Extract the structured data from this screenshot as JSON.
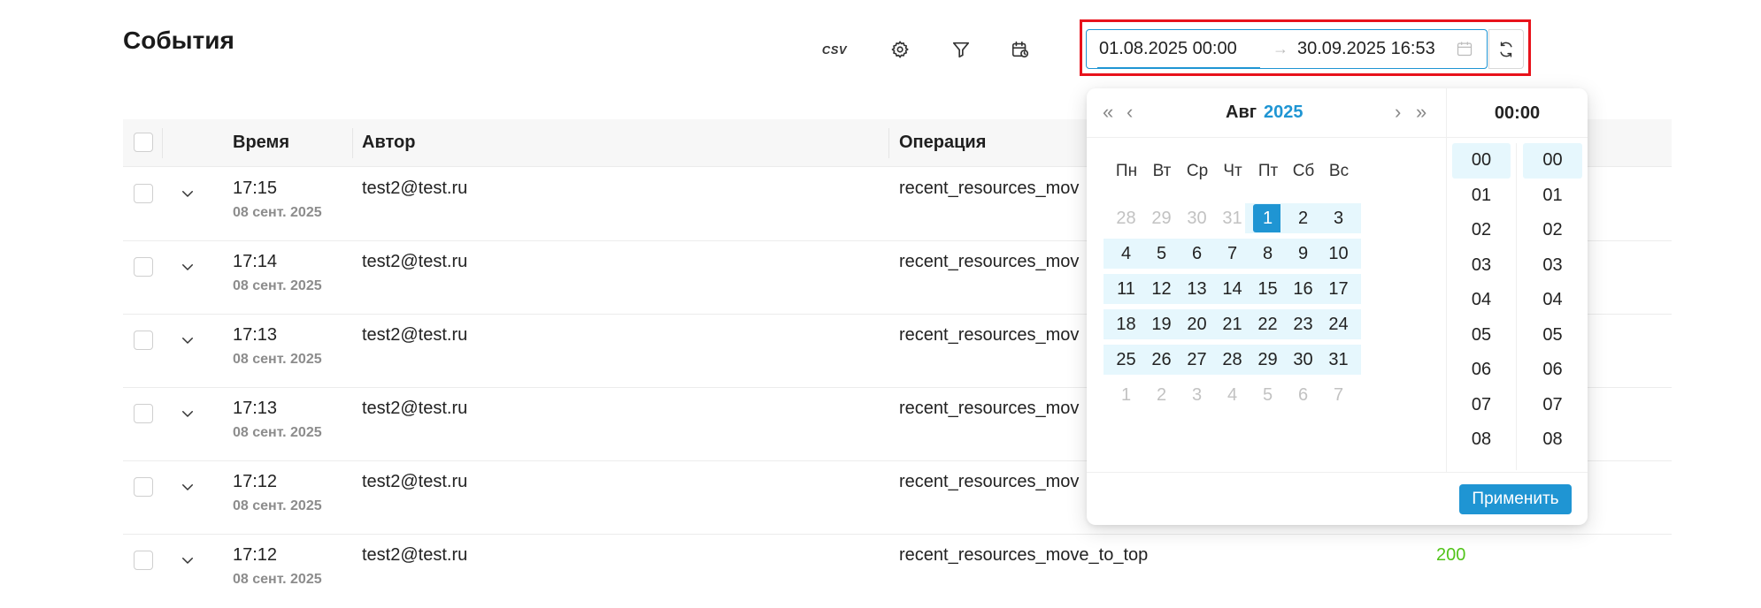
{
  "header": {
    "title": "События",
    "csv_label": "CSV",
    "icons": [
      "settings-icon",
      "filter-icon",
      "calendar-clock-icon"
    ]
  },
  "range": {
    "start": "01.08.2025 00:00",
    "separator": "→",
    "end": "30.09.2025 16:53"
  },
  "table": {
    "headers": {
      "time": "Время",
      "author": "Автор",
      "operation": "Операция"
    },
    "rows": [
      {
        "time": "17:15",
        "date": "08 сент. 2025",
        "author": "test2@test.ru",
        "operation": "recent_resources_mov",
        "status": ""
      },
      {
        "time": "17:14",
        "date": "08 сент. 2025",
        "author": "test2@test.ru",
        "operation": "recent_resources_mov",
        "status": ""
      },
      {
        "time": "17:13",
        "date": "08 сент. 2025",
        "author": "test2@test.ru",
        "operation": "recent_resources_mov",
        "status": ""
      },
      {
        "time": "17:13",
        "date": "08 сент. 2025",
        "author": "test2@test.ru",
        "operation": "recent_resources_mov",
        "status": ""
      },
      {
        "time": "17:12",
        "date": "08 сент. 2025",
        "author": "test2@test.ru",
        "operation": "recent_resources_mov",
        "status": ""
      },
      {
        "time": "17:12",
        "date": "08 сент. 2025",
        "author": "test2@test.ru",
        "operation": "recent_resources_move_to_top",
        "status": "200"
      }
    ]
  },
  "picker": {
    "month": "Авг",
    "year": "2025",
    "nav": {
      "prev_year": "«",
      "prev_month": "‹",
      "next_month": "›",
      "next_year": "»"
    },
    "weekdays": [
      "Пн",
      "Вт",
      "Ср",
      "Чт",
      "Пт",
      "Сб",
      "Вс"
    ],
    "weeks": [
      [
        "28",
        "29",
        "30",
        "31",
        "1",
        "2",
        "3"
      ],
      [
        "4",
        "5",
        "6",
        "7",
        "8",
        "9",
        "10"
      ],
      [
        "11",
        "12",
        "13",
        "14",
        "15",
        "16",
        "17"
      ],
      [
        "18",
        "19",
        "20",
        "21",
        "22",
        "23",
        "24"
      ],
      [
        "25",
        "26",
        "27",
        "28",
        "29",
        "30",
        "31"
      ],
      [
        "1",
        "2",
        "3",
        "4",
        "5",
        "6",
        "7"
      ]
    ],
    "selected_day": "1",
    "time_header": "00:00",
    "hours": [
      "00",
      "01",
      "02",
      "03",
      "04",
      "05",
      "06",
      "07",
      "08"
    ],
    "minutes": [
      "00",
      "01",
      "02",
      "03",
      "04",
      "05",
      "06",
      "07",
      "08"
    ],
    "apply_label": "Применить"
  },
  "colors": {
    "accent": "#1f95d3",
    "range_bg": "#e6f7fd",
    "status_ok": "#52c41a",
    "highlight": "#e8121b"
  }
}
